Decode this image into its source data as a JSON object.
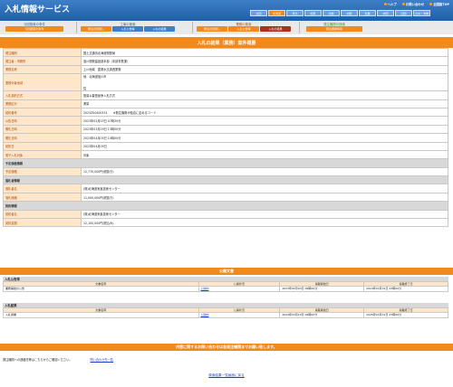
{
  "app_title": "入札情報サービス",
  "top_links": [
    "ヘルプ",
    "お問い合わせ",
    "全国版TOP"
  ],
  "regions": [
    "全国",
    "北海道",
    "東北",
    "関東",
    "北陸",
    "中部",
    "近畿",
    "中国",
    "四国",
    "九州・沖縄"
  ],
  "active_region": "北海道",
  "search_groups": [
    {
      "title": "今回検索の条件",
      "buttons": [
        "今回検索の条件"
      ]
    },
    {
      "title": "工事の検索",
      "buttons": [
        "発注の見通し",
        "入札公告等",
        "入札の結果"
      ]
    },
    {
      "title": "業務の検索",
      "buttons": [
        "発注の見通し",
        "入札公告等",
        "入札の結果"
      ]
    },
    {
      "title": "発注機関の検索",
      "buttons": [
        "発注機関情報"
      ]
    }
  ],
  "detail_title": "入札の結果（業務）案件概要",
  "detail_rows": [
    {
      "k": "発注機関",
      "v": "国土交通省北海道開発局"
    },
    {
      "k": "発注者・事務所",
      "v": "旭川開発建設部本部（本部事業課）"
    },
    {
      "k": "業務名称",
      "v": "上川地域　農業水文調査業務"
    },
    {
      "k": "業務対象地域",
      "v": "他：北海道旭川市\n\n\n従"
    },
    {
      "k": "入札契約方式",
      "v": "簡易公募型競争入札方式"
    },
    {
      "k": "業務区分",
      "v": "測量"
    },
    {
      "k": "契約番号",
      "v": "2023Z50400331　　※発注機関が独自に定めるコード"
    },
    {
      "k": "公告日時",
      "v": "2023年02月03日 07時30分"
    },
    {
      "k": "開札日時",
      "v": "2023年03月29日 13時00分"
    },
    {
      "k": "開札日時",
      "v": "2023年04月05日 10時00分"
    },
    {
      "k": "契約日",
      "v": "2023年04月05日"
    },
    {
      "k": "電子入札対象",
      "v": "対象"
    },
    {
      "sec": "予定価格情報"
    },
    {
      "k": "予定価格",
      "v": "12,770,000円(税抜き)"
    },
    {
      "sec": "落札者情報"
    },
    {
      "k": "落札者名",
      "v": "(株)北海道気象技術センター"
    },
    {
      "k": "落札価格",
      "v": "11,000,000円(税抜き)"
    },
    {
      "sec": "契約情報"
    },
    {
      "k": "契約者名",
      "v": "(株)北海道気象技術センター"
    },
    {
      "k": "契約金額",
      "v": "12,100,000円(税込み)"
    }
  ],
  "docs_title": "公開文書",
  "docs": [
    {
      "section": "入札公告等",
      "headers": [
        "文書名称",
        "公開状況",
        "掲載開始日",
        "掲載終了日"
      ],
      "rows": [
        [
          "業務開始の公告",
          "公開中",
          "2023年02月03日 09時00分",
          "2024年03月31日 23時00分"
        ]
      ]
    },
    {
      "section": "入札結果",
      "headers": [
        "文書名称",
        "公開状況",
        "掲載開始日",
        "掲載終了日"
      ],
      "rows": [
        [
          "入札調書",
          "公開中",
          "2024年03月19日 09時00分",
          "2025年03月31日 23時00分"
        ]
      ]
    }
  ],
  "contact_band": "内容に関するお問い合わせは各発注機関までお願い致します。",
  "contact_note": "発注機関への連絡先等はこちらからご確認ください。",
  "contact_link": "問い合わせ先一覧",
  "back_link": "検索結果一覧画面に戻る"
}
